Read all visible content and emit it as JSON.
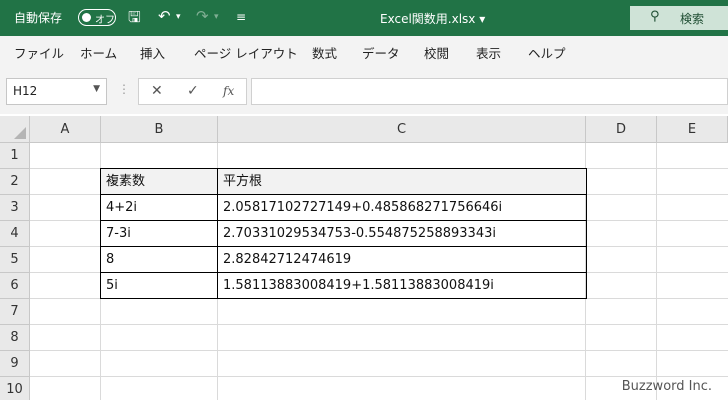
{
  "titlebar": {
    "autosave_label": "自動保存",
    "autosave_state": "オフ",
    "filename": "Excel関数用.xlsx ▾",
    "search_label": "検索",
    "accent_color": "#217346"
  },
  "menu": {
    "items": [
      "ファイル",
      "ホーム",
      "挿入",
      "ページ レイアウト",
      "数式",
      "データ",
      "校閲",
      "表示",
      "ヘルプ"
    ]
  },
  "formula_bar": {
    "name_box": "H12",
    "cancel_icon": "✕",
    "enter_icon": "✓",
    "fx_label": "fx",
    "formula": ""
  },
  "grid": {
    "columns": [
      "A",
      "B",
      "C",
      "D",
      "E"
    ],
    "rows": [
      "1",
      "2",
      "3",
      "4",
      "5",
      "6",
      "7",
      "8",
      "9",
      "10"
    ],
    "table": {
      "header": [
        "複素数",
        "平方根"
      ],
      "body": [
        [
          "4+2i",
          "2.05817102727149+0.485868271756646i"
        ],
        [
          "7-3i",
          "2.70331029534753-0.554875258893343i"
        ],
        [
          "8",
          "2.82842712474619"
        ],
        [
          "5i",
          "1.58113883008419+1.58113883008419i"
        ]
      ]
    }
  },
  "watermark": "Buzzword Inc."
}
